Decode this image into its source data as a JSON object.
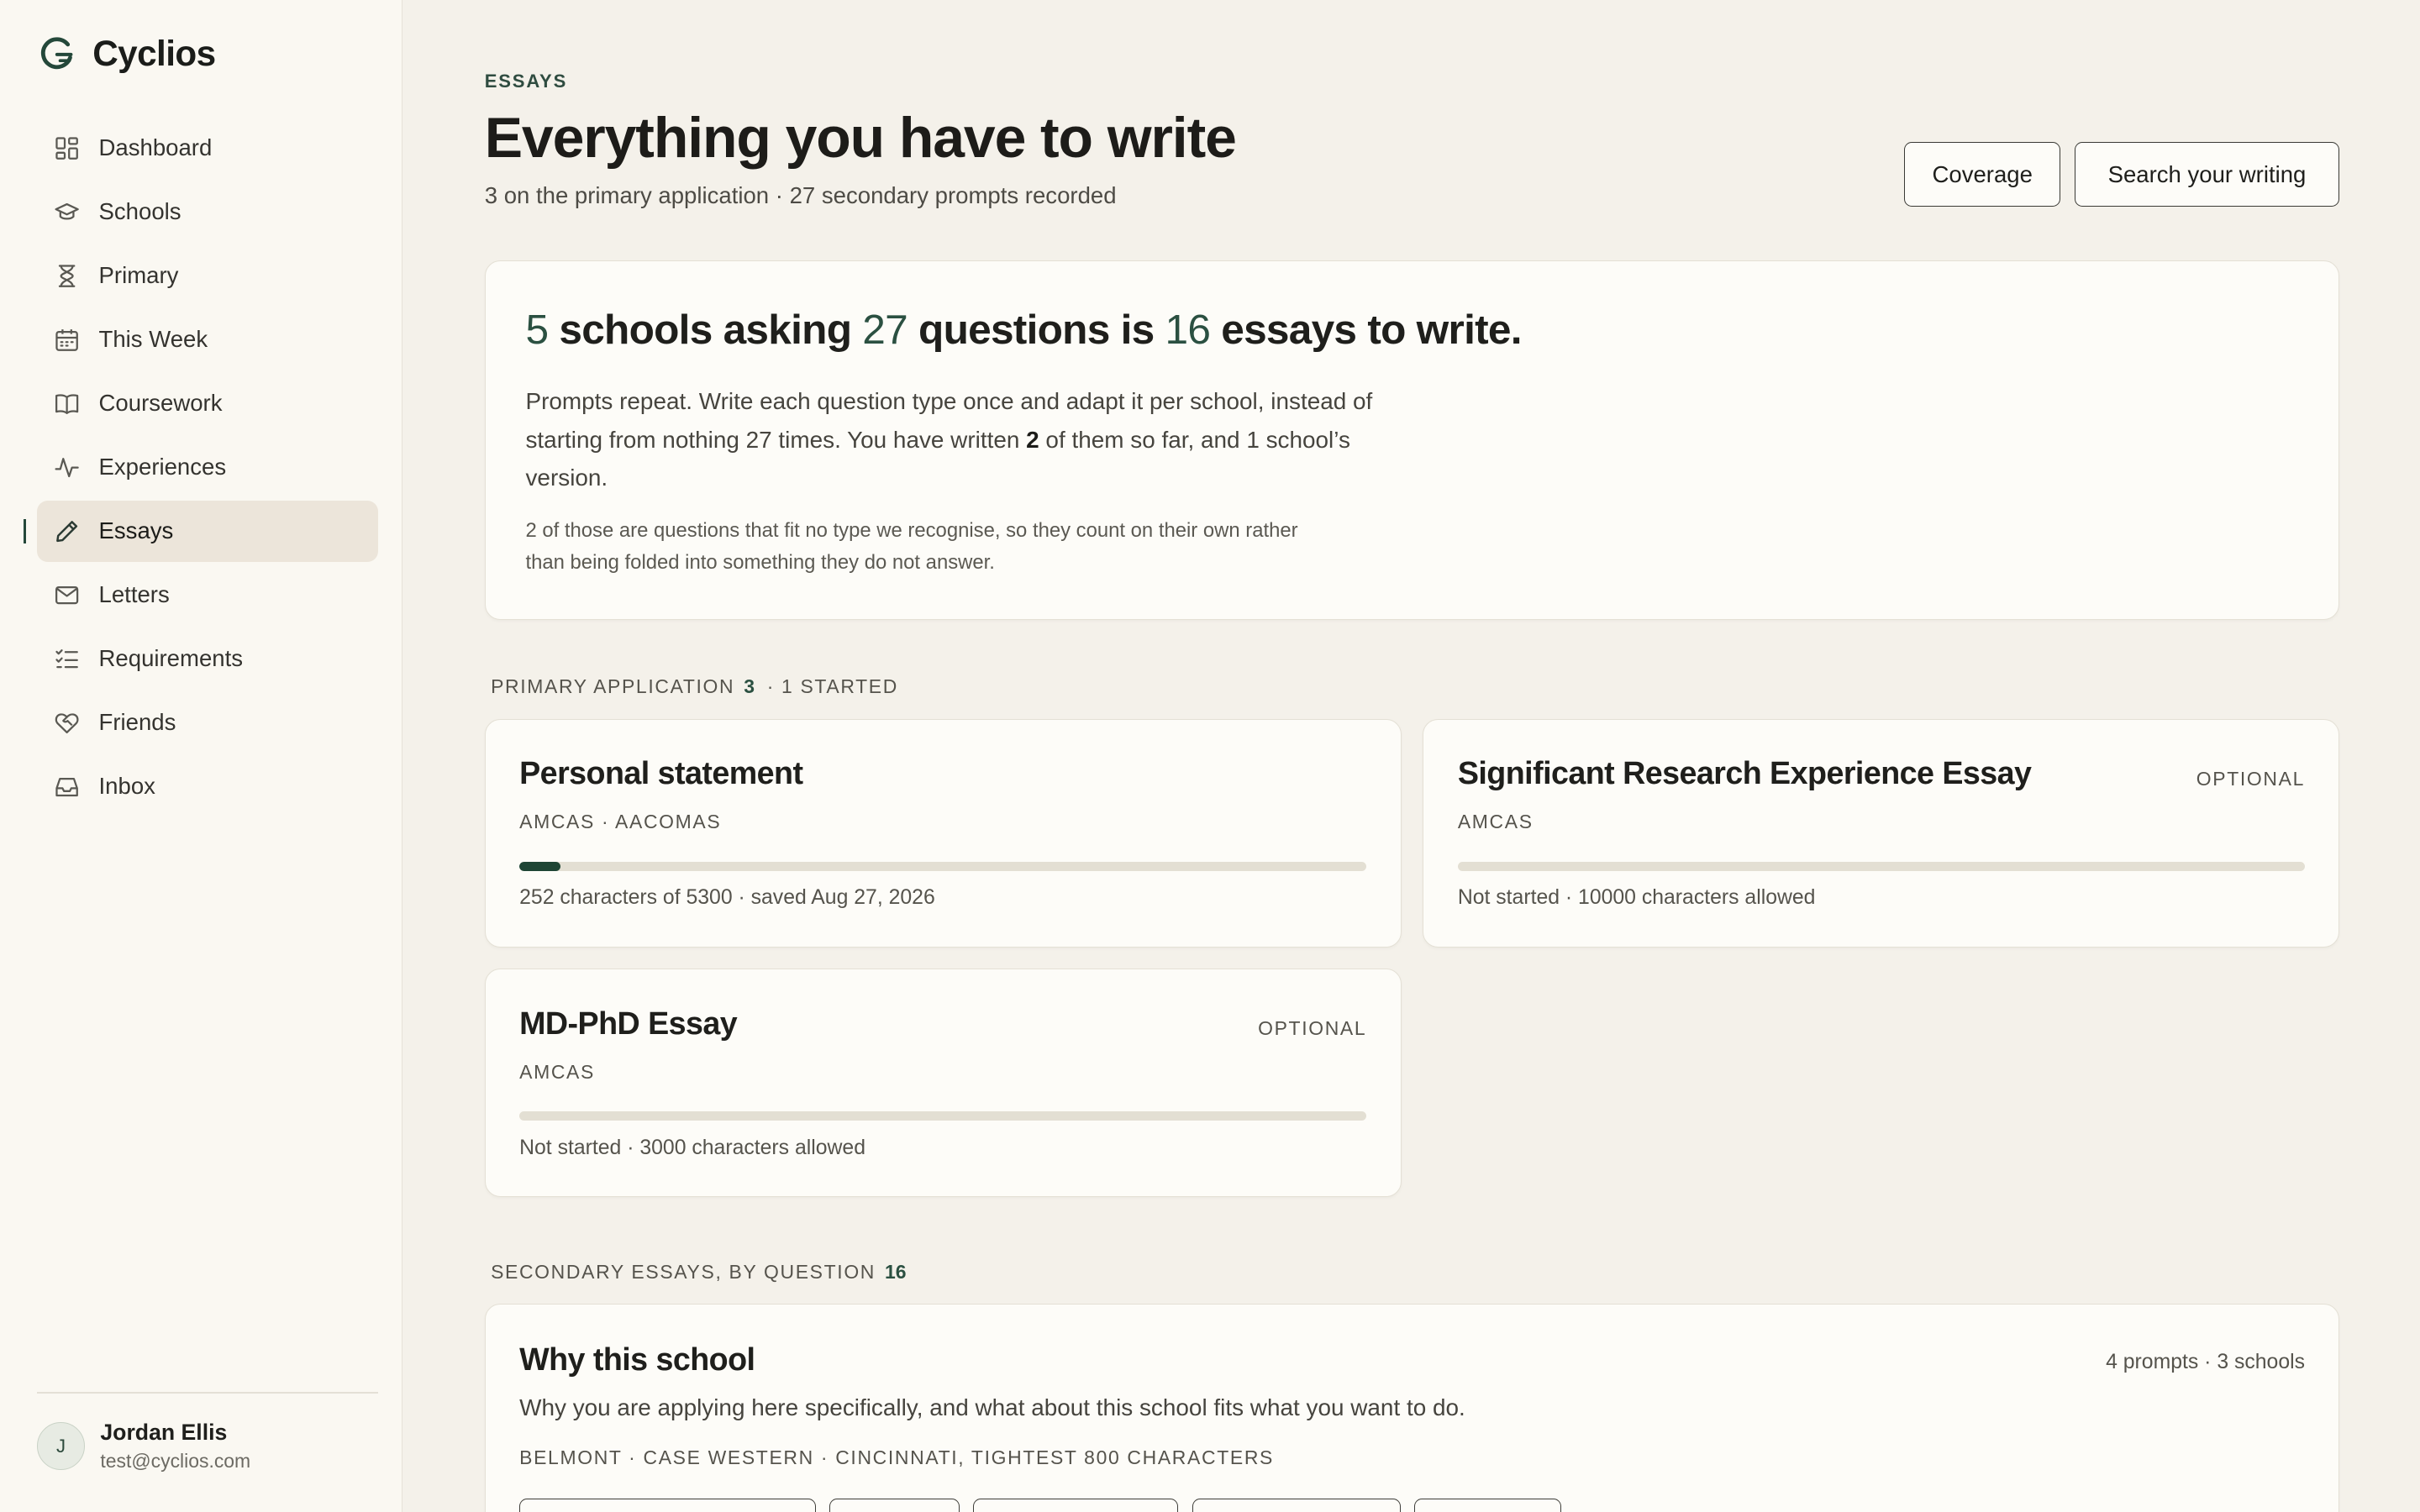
{
  "app": {
    "name": "Cyclios"
  },
  "sidebar": {
    "items": [
      {
        "label": "Dashboard",
        "icon": "dashboard-icon"
      },
      {
        "label": "Schools",
        "icon": "graduation-cap-icon"
      },
      {
        "label": "Primary",
        "icon": "hourglass-icon"
      },
      {
        "label": "This Week",
        "icon": "calendar-icon"
      },
      {
        "label": "Coursework",
        "icon": "book-icon"
      },
      {
        "label": "Experiences",
        "icon": "activity-icon"
      },
      {
        "label": "Essays",
        "icon": "pen-icon",
        "active": true
      },
      {
        "label": "Letters",
        "icon": "mail-icon"
      },
      {
        "label": "Requirements",
        "icon": "checklist-icon"
      },
      {
        "label": "Friends",
        "icon": "heart-handshake-icon"
      },
      {
        "label": "Inbox",
        "icon": "inbox-icon"
      }
    ]
  },
  "user": {
    "initial": "J",
    "name": "Jordan Ellis",
    "email": "test@cyclios.com"
  },
  "header": {
    "eyebrow": "ESSAYS",
    "title": "Everything you have to write",
    "subtitle": "3 on the primary application · 27 secondary prompts recorded",
    "coverage_label": "Coverage",
    "search_label": "Search your writing"
  },
  "summary": {
    "schools": "5",
    "schools_text": " schools asking ",
    "questions": "27",
    "questions_text": " questions is ",
    "essays": "16",
    "essays_text": " essays to write.",
    "body_pre": "Prompts repeat. Write each question type once and adapt it per school, instead of starting from nothing 27 times. You have written ",
    "body_written": "2",
    "body_post": " of them so far, and 1 school’s version.",
    "note": "2 of those are questions that fit no type we recognise, so they count on their own rather than being folded into something they do not answer."
  },
  "primary": {
    "label": "PRIMARY APPLICATION",
    "count": "3",
    "extra": "· 1 STARTED",
    "essays": [
      {
        "title": "Personal statement",
        "tag": "",
        "orgs": "AMCAS · AACOMAS",
        "progress": 0.048,
        "status": "252 characters of 5300 · saved Aug 27, 2026"
      },
      {
        "title": "Significant Research Experience Essay",
        "tag": "OPTIONAL",
        "orgs": "AMCAS",
        "progress": 0,
        "status": "Not started · 10000 characters allowed"
      },
      {
        "title": "MD-PhD Essay",
        "tag": "OPTIONAL",
        "orgs": "AMCAS",
        "progress": 0,
        "status": "Not started · 3000 characters allowed"
      }
    ]
  },
  "secondary": {
    "label": "SECONDARY ESSAYS, BY QUESTION",
    "count": "16",
    "questions": [
      {
        "title": "Why this school",
        "meta": "4 prompts · 3 schools",
        "description": "Why you are applying here specifically, and what about this school fits what you want to do.",
        "schools": "BELMONT · CASE WESTERN · CINCINNATI, TIGHTEST 800 CHARACTERS"
      }
    ]
  },
  "colors": {
    "accent": "#24483a",
    "background": "#f4f1ea",
    "card": "#fdfcf8"
  }
}
